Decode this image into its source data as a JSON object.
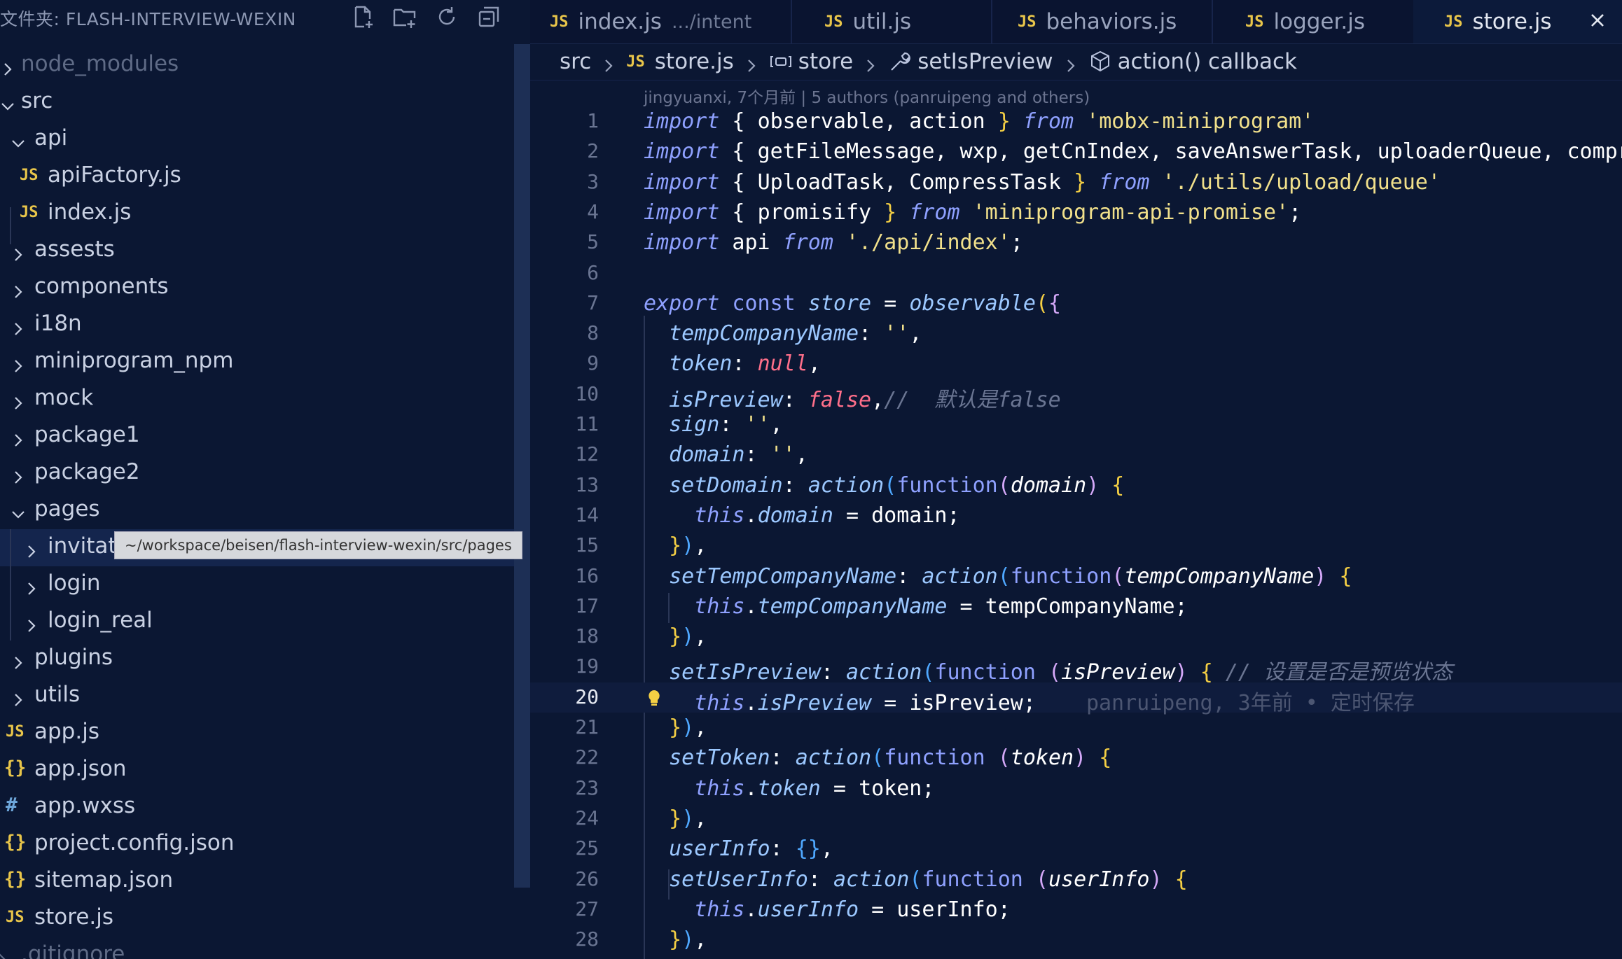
{
  "explorer": {
    "title": "文件夹: FLASH-INTERVIEW-WEXIN",
    "actions": [
      "new-file-icon",
      "new-folder-icon",
      "refresh-icon",
      "collapse-all-icon"
    ],
    "tooltip": "~/workspace/beisen/flash-interview-wexin/src/pages",
    "items": [
      {
        "label": "node_modules",
        "kind": "folder",
        "open": false
      },
      {
        "label": "src",
        "kind": "folder",
        "open": true
      },
      {
        "label": "api",
        "kind": "folder",
        "open": true
      },
      {
        "label": "apiFactory.js",
        "kind": "js"
      },
      {
        "label": "index.js",
        "kind": "js"
      },
      {
        "label": "assests",
        "kind": "folder",
        "open": false
      },
      {
        "label": "components",
        "kind": "folder",
        "open": false
      },
      {
        "label": "i18n",
        "kind": "folder",
        "open": false
      },
      {
        "label": "miniprogram_npm",
        "kind": "folder",
        "open": false
      },
      {
        "label": "mock",
        "kind": "folder",
        "open": false
      },
      {
        "label": "package1",
        "kind": "folder",
        "open": false
      },
      {
        "label": "package2",
        "kind": "folder",
        "open": false
      },
      {
        "label": "pages",
        "kind": "folder",
        "open": true
      },
      {
        "label": "invitati",
        "kind": "folder",
        "open": false
      },
      {
        "label": "login",
        "kind": "folder",
        "open": false
      },
      {
        "label": "login_real",
        "kind": "folder",
        "open": false
      },
      {
        "label": "plugins",
        "kind": "folder",
        "open": false
      },
      {
        "label": "utils",
        "kind": "folder",
        "open": false
      },
      {
        "label": "app.js",
        "kind": "js"
      },
      {
        "label": "app.json",
        "kind": "json"
      },
      {
        "label": "app.wxss",
        "kind": "css"
      },
      {
        "label": "project.config.json",
        "kind": "json"
      },
      {
        "label": "sitemap.json",
        "kind": "json"
      },
      {
        "label": "store.js",
        "kind": "js"
      },
      {
        "label": ".gitignore",
        "kind": "file"
      }
    ]
  },
  "tabs": [
    {
      "label": "index.js",
      "description": ".../intent",
      "badge": "JS"
    },
    {
      "label": "util.js",
      "badge": "JS"
    },
    {
      "label": "behaviors.js",
      "badge": "JS"
    },
    {
      "label": "logger.js",
      "badge": "JS"
    },
    {
      "label": "store.js",
      "badge": "JS",
      "active": true
    }
  ],
  "breadcrumb": {
    "folder": "src",
    "file": "store.js",
    "file_badge": "JS",
    "symbol1": "store",
    "symbol2": "setIsPreview",
    "symbol3": "action() callback"
  },
  "codelens": "jingyuanxi, 7个月前 | 5 authors (panruipeng and others)",
  "inline_blame": "panruipeng, 3年前 • 定时保存",
  "current_line": 20,
  "line_numbers": [
    "1",
    "2",
    "3",
    "4",
    "5",
    "6",
    "7",
    "8",
    "9",
    "10",
    "11",
    "12",
    "13",
    "14",
    "15",
    "16",
    "17",
    "18",
    "19",
    "20",
    "21",
    "22",
    "23",
    "24",
    "25",
    "26",
    "27",
    "28"
  ],
  "code": {
    "l1": [
      "import",
      " { ",
      "observable, action",
      " } ",
      "from",
      " ",
      "'mobx-miniprogram'"
    ],
    "l2": [
      "import",
      " { ",
      "getFileMessage, wxp, getCnIndex, saveAnswerTask, uploaderQueue, compress"
    ],
    "l3": [
      "import",
      " { ",
      "UploadTask, CompressTask",
      " } ",
      "from",
      " ",
      "'./utils/upload/queue'"
    ],
    "l4": [
      "import",
      " { ",
      "promisify",
      " } ",
      "from",
      " ",
      "'miniprogram-api-promise'",
      ";"
    ],
    "l5": [
      "import",
      " api ",
      "from",
      " ",
      "'./api/index'",
      ";"
    ],
    "l7": [
      "export",
      " const ",
      "store",
      " = ",
      "observable",
      "(",
      "{"
    ],
    "l8": [
      "tempCompanyName",
      ": ",
      "''",
      ","
    ],
    "l9": [
      "token",
      ": ",
      "null",
      ","
    ],
    "l10": [
      "isPreview",
      ": ",
      "false",
      ",",
      "//  默认是false"
    ],
    "l11": [
      "sign",
      ": ",
      "''",
      ","
    ],
    "l12": [
      "domain",
      ": ",
      "''",
      ","
    ],
    "l13": [
      "setDomain",
      ": ",
      "action",
      "(",
      "function",
      "(",
      "domain",
      ")",
      " {"
    ],
    "l14": [
      "this",
      ".",
      "domain",
      " = ",
      "domain;"
    ],
    "l15": [
      "}",
      ")",
      ","
    ],
    "l16": [
      "setTempCompanyName",
      ": ",
      "action",
      "(",
      "function",
      "(",
      "tempCompanyName",
      ")",
      " {"
    ],
    "l17": [
      "this",
      ".",
      "tempCompanyName",
      " = ",
      "tempCompanyName;"
    ],
    "l18": [
      "}",
      ")",
      ","
    ],
    "l19": [
      "setIsPreview",
      ": ",
      "action",
      "(",
      "function",
      " (",
      "isPreview",
      ")",
      " {",
      " // 设置是否是预览状态"
    ],
    "l20": [
      "this",
      ".",
      "isPreview",
      " = ",
      "isPreview;"
    ],
    "l21": [
      "}",
      ")",
      ","
    ],
    "l22": [
      "setToken",
      ": ",
      "action",
      "(",
      "function",
      " (",
      "token",
      ")",
      " {"
    ],
    "l23": [
      "this",
      ".",
      "token",
      " = ",
      "token;"
    ],
    "l24": [
      "}",
      ")",
      ","
    ],
    "l25": [
      "userInfo",
      ": ",
      "{}",
      ","
    ],
    "l26": [
      "setUserInfo",
      ": ",
      "action",
      "(",
      "function",
      " (",
      "userInfo",
      ")",
      " {"
    ],
    "l27": [
      "this",
      ".",
      "userInfo",
      " = ",
      "userInfo;"
    ],
    "l28": [
      "}",
      ")",
      ","
    ]
  },
  "colors": {
    "background": "#0b1733",
    "keyword": "#8fa1ff",
    "string": "#f1e08b",
    "boolean": "#ff6f8a",
    "js_badge": "#e8c54a"
  }
}
